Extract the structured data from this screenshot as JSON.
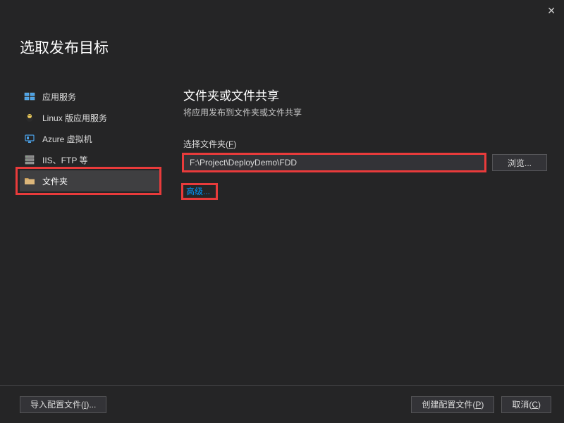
{
  "dialog": {
    "title": "选取发布目标"
  },
  "sidebar": {
    "items": [
      {
        "label": "应用服务"
      },
      {
        "label": "Linux 版应用服务"
      },
      {
        "label": "Azure 虚拟机"
      },
      {
        "label": "IIS、FTP 等"
      },
      {
        "label": "文件夹"
      }
    ]
  },
  "main": {
    "title": "文件夹或文件共享",
    "subtitle": "将应用发布到文件夹或文件共享",
    "folder_label_text": "选择文件夹(",
    "folder_label_mnemonic": "F",
    "folder_label_suffix": ")",
    "folder_path": "F:\\Project\\DeployDemo\\FDD",
    "browse_label": "浏览...",
    "advanced_label": "高级..."
  },
  "footer": {
    "import_label_text": "导入配置文件(",
    "import_mnemonic": "I",
    "import_suffix": ")...",
    "create_label_text": "创建配置文件(",
    "create_mnemonic": "P",
    "create_suffix": ")",
    "cancel_label_text": "取消(",
    "cancel_mnemonic": "C",
    "cancel_suffix": ")"
  }
}
